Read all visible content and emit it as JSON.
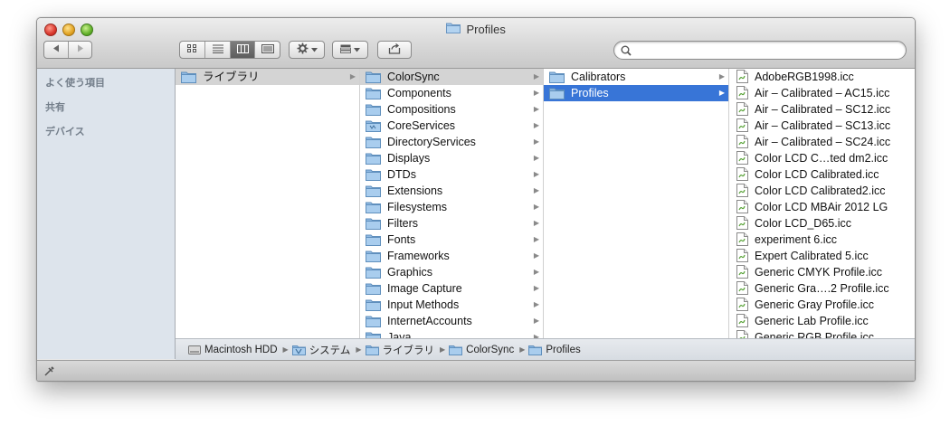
{
  "window": {
    "title": "Profiles"
  },
  "toolbar": {
    "search_placeholder": ""
  },
  "sidebar": {
    "sections": [
      "よく使う項目",
      "共有",
      "デバイス"
    ]
  },
  "columns": [
    {
      "items": [
        {
          "label": "ライブラリ",
          "selected": true
        }
      ]
    },
    {
      "items": [
        {
          "label": "ColorSync",
          "selected": true
        },
        {
          "label": "Components"
        },
        {
          "label": "Compositions"
        },
        {
          "label": "CoreServices"
        },
        {
          "label": "DirectoryServices"
        },
        {
          "label": "Displays"
        },
        {
          "label": "DTDs"
        },
        {
          "label": "Extensions"
        },
        {
          "label": "Filesystems"
        },
        {
          "label": "Filters"
        },
        {
          "label": "Fonts"
        },
        {
          "label": "Frameworks"
        },
        {
          "label": "Graphics"
        },
        {
          "label": "Image Capture"
        },
        {
          "label": "Input Methods"
        },
        {
          "label": "InternetAccounts"
        },
        {
          "label": "Java"
        }
      ]
    },
    {
      "items": [
        {
          "label": "Calibrators"
        },
        {
          "label": "Profiles",
          "selected": true
        }
      ]
    }
  ],
  "files": [
    "AdobeRGB1998.icc",
    "Air – Calibrated – AC15.icc",
    "Air – Calibrated – SC12.icc",
    "Air – Calibrated – SC13.icc",
    "Air – Calibrated – SC24.icc",
    "Color LCD C…ted dm2.icc",
    "Color LCD Calibrated.icc",
    "Color LCD Calibrated2.icc",
    "Color LCD MBAir 2012 LG",
    "Color LCD_D65.icc",
    "experiment 6.icc",
    "Expert Calibrated 5.icc",
    "Generic CMYK Profile.icc",
    "Generic Gra….2 Profile.icc",
    "Generic Gray Profile.icc",
    "Generic Lab Profile.icc",
    "Generic RGB Profile.icc"
  ],
  "pathbar": [
    "Macintosh HDD",
    "システム",
    "ライブラリ",
    "ColorSync",
    "Profiles"
  ],
  "colors": {
    "selection_blue": "#3875d7",
    "sidebar_bg": "#dde4ec"
  }
}
